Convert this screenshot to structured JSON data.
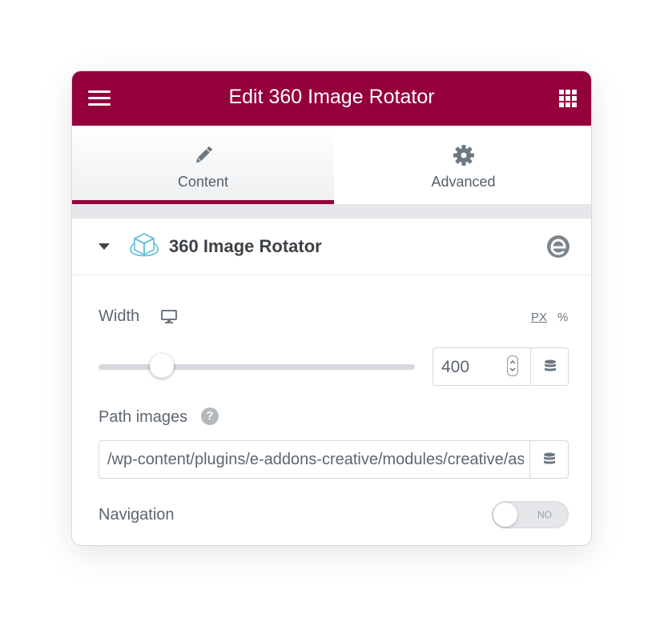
{
  "header": {
    "title": "Edit 360 Image Rotator",
    "menu_icon": "hamburger-icon",
    "grid_icon": "grid-icon",
    "background": "#93003c"
  },
  "tabs": [
    {
      "label": "Content",
      "icon": "pencil-icon",
      "active": true
    },
    {
      "label": "Advanced",
      "icon": "gear-icon",
      "active": false
    }
  ],
  "section": {
    "title": "360 Image Rotator",
    "icon": "cube-icon",
    "brand_icon": "e-addons-logo-icon"
  },
  "width_control": {
    "label": "Width",
    "device_icon": "desktop-icon",
    "units": [
      "PX",
      "%"
    ],
    "selected_unit": "PX",
    "value": "400",
    "slider_fraction": 0.2
  },
  "path_control": {
    "label": "Path images",
    "help_icon": "question-icon",
    "help_text": "?",
    "value": "/wp-content/plugins/e-addons-creative/modules/creative/assets/images/"
  },
  "navigation_control": {
    "label": "Navigation",
    "toggle_state": "NO"
  },
  "colors": {
    "accent": "#93003c",
    "text": "#5d6670",
    "border": "#d5d8dc"
  }
}
